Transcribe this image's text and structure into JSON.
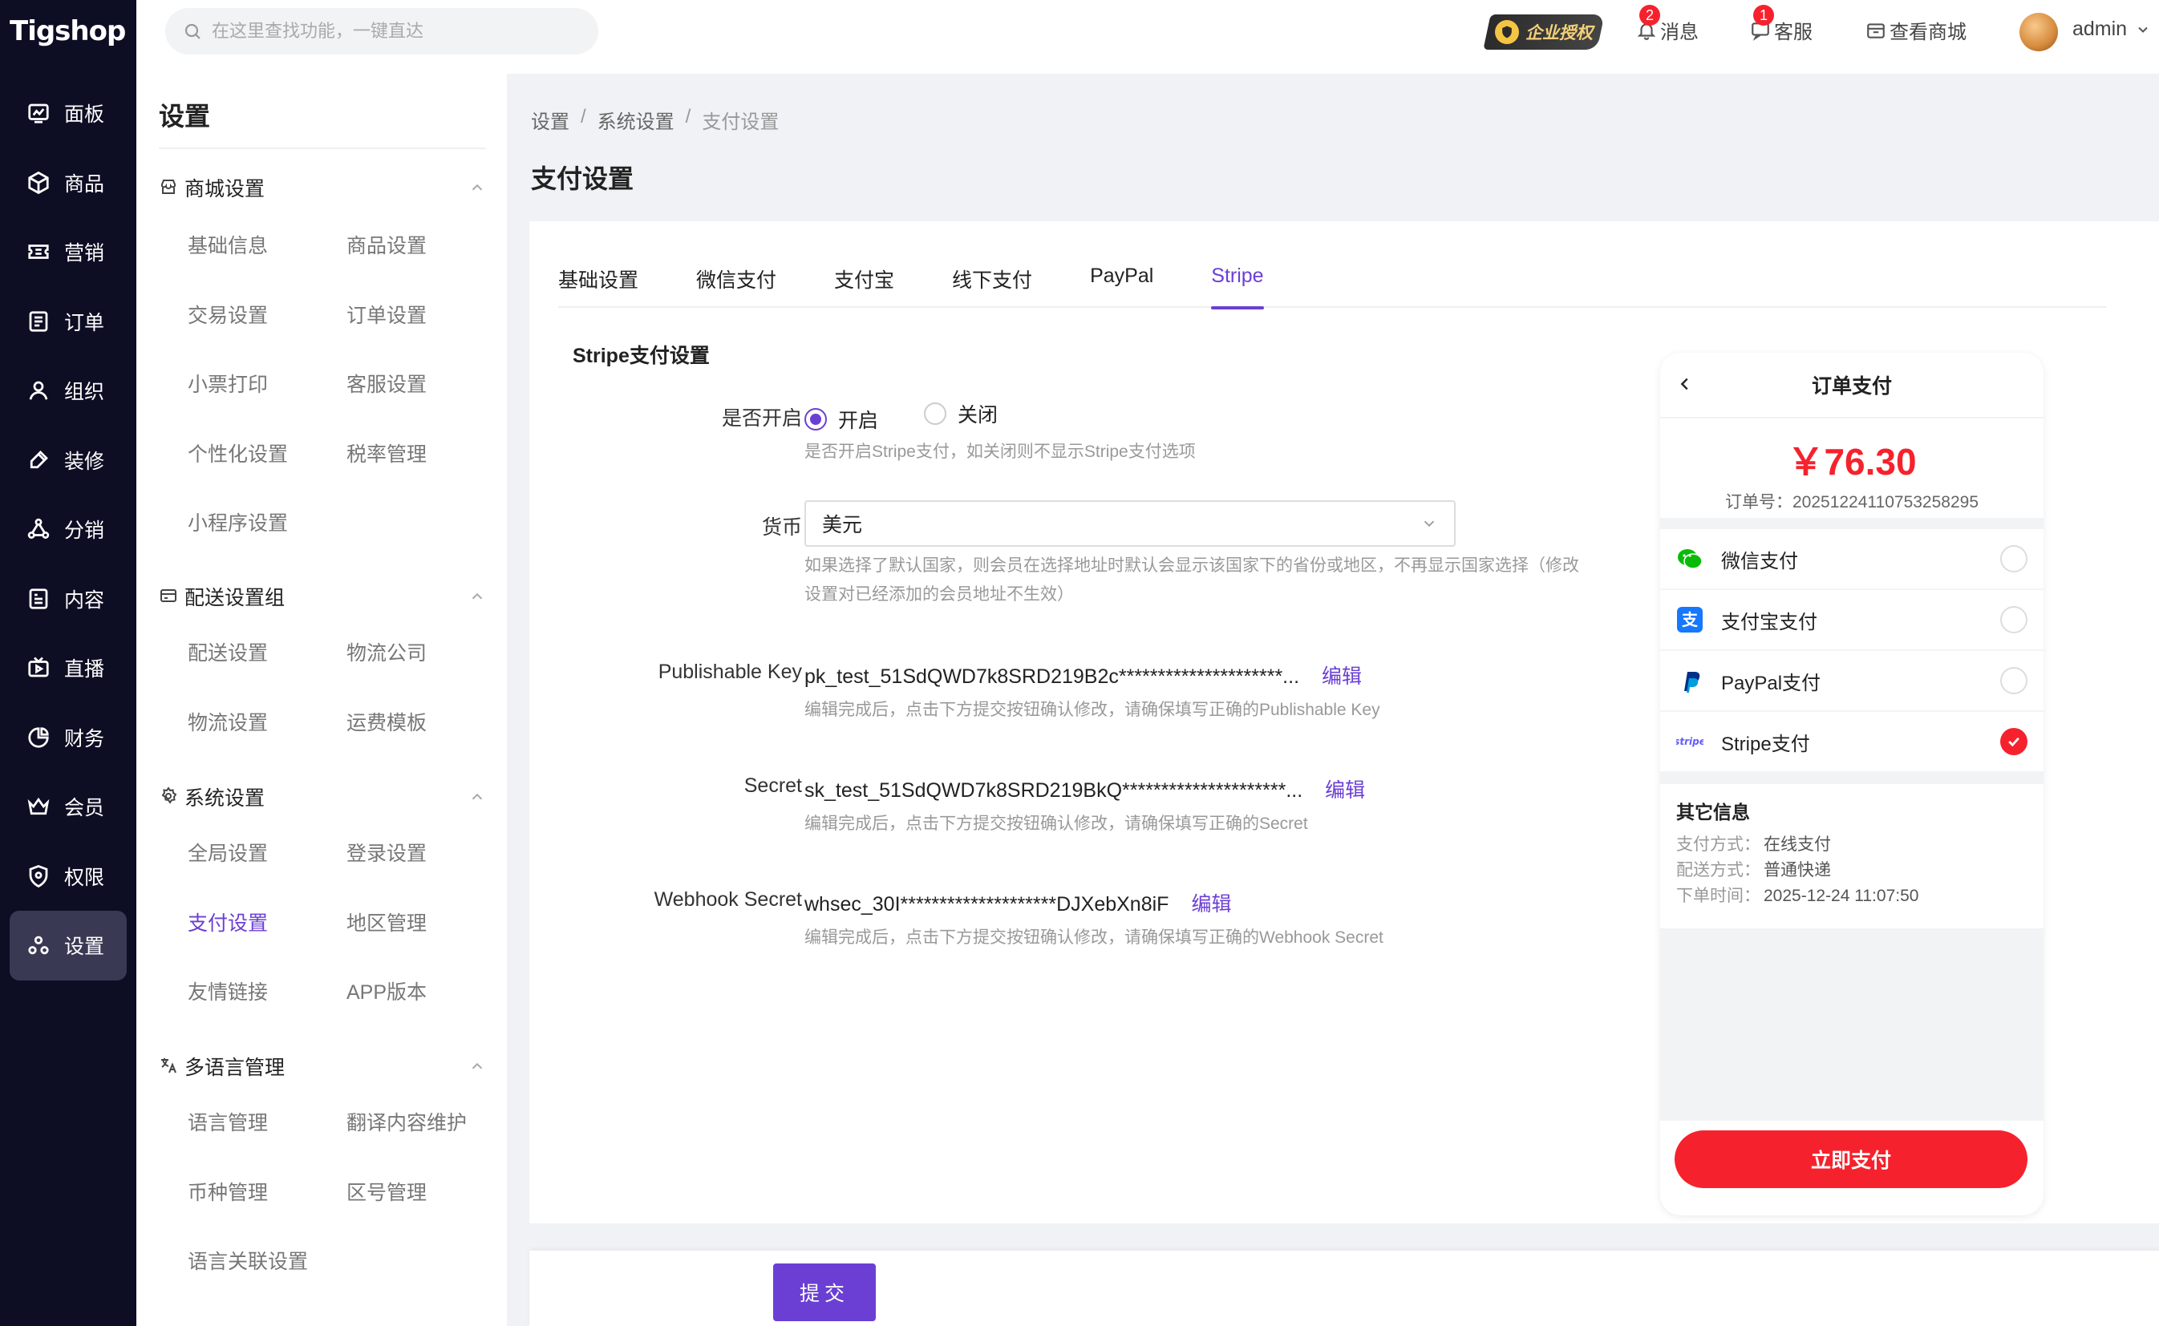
{
  "brand": {
    "logo_text": "Tigshop"
  },
  "search": {
    "placeholder": "在这里查找功能，一键直达"
  },
  "topbar": {
    "auth_label": "企业授权",
    "messages_label": "消息",
    "messages_count": "2",
    "service_label": "客服",
    "service_count": "1",
    "store_label": "查看商城",
    "user_name": "admin"
  },
  "rail": {
    "items": [
      {
        "label": "面板",
        "icon": "dashboard-icon"
      },
      {
        "label": "商品",
        "icon": "box-icon"
      },
      {
        "label": "营销",
        "icon": "coupon-icon"
      },
      {
        "label": "订单",
        "icon": "order-icon"
      },
      {
        "label": "组织",
        "icon": "user-icon"
      },
      {
        "label": "装修",
        "icon": "brush-icon"
      },
      {
        "label": "分销",
        "icon": "share-icon"
      },
      {
        "label": "内容",
        "icon": "content-icon"
      },
      {
        "label": "直播",
        "icon": "live-icon"
      },
      {
        "label": "财务",
        "icon": "pie-icon"
      },
      {
        "label": "会员",
        "icon": "crown-icon"
      },
      {
        "label": "权限",
        "icon": "shield-icon"
      },
      {
        "label": "设置",
        "icon": "settings-icon",
        "active": true
      }
    ]
  },
  "subside": {
    "title": "设置",
    "groups": [
      {
        "title": "商城设置",
        "items": [
          "基础信息",
          "商品设置",
          "交易设置",
          "订单设置",
          "小票打印",
          "客服设置",
          "个性化设置",
          "税率管理",
          "小程序设置"
        ]
      },
      {
        "title": "配送设置组",
        "items": [
          "配送设置",
          "物流公司",
          "物流设置",
          "运费模板"
        ]
      },
      {
        "title": "系统设置",
        "items": [
          "全局设置",
          "登录设置",
          "支付设置",
          "地区管理",
          "友情链接",
          "APP版本"
        ]
      },
      {
        "title": "多语言管理",
        "items": [
          "语言管理",
          "翻译内容维护",
          "币种管理",
          "区号管理",
          "语言关联设置"
        ]
      }
    ]
  },
  "breadcrumb": [
    "设置",
    "系统设置",
    "支付设置"
  ],
  "page_title": "支付设置",
  "tabs": [
    "基础设置",
    "微信支付",
    "支付宝",
    "线下支付",
    "PayPal",
    "Stripe"
  ],
  "form": {
    "section_title": "Stripe支付设置",
    "enable": {
      "label": "是否开启",
      "on": "开启",
      "off": "关闭",
      "help": "是否开启Stripe支付，如关闭则不显示Stripe支付选项"
    },
    "currency": {
      "label": "货币",
      "value": "美元",
      "help": "如果选择了默认国家，则会员在选择地址时默认会显示该国家下的省份或地区，不再显示国家选择（修改设置对已经添加的会员地址不生效）"
    },
    "publishable": {
      "label": "Publishable Key",
      "value": "pk_test_51SdQWD7k8SRD219B2c*********************...",
      "edit": "编辑",
      "help": "编辑完成后，点击下方提交按钮确认修改，请确保填写正确的Publishable Key"
    },
    "secret": {
      "label": "Secret",
      "value": "sk_test_51SdQWD7k8SRD219BkQ*********************...",
      "edit": "编辑",
      "help": "编辑完成后，点击下方提交按钮确认修改，请确保填写正确的Secret"
    },
    "webhook": {
      "label": "Webhook Secret",
      "value": "whsec_30I********************DJXebXn8iF",
      "edit": "编辑",
      "help": "编辑完成后，点击下方提交按钮确认修改，请确保填写正确的Webhook Secret"
    }
  },
  "preview": {
    "title": "订单支付",
    "price": "￥76.30",
    "order_no": "订单号：20251224110753258295",
    "methods": [
      {
        "label": "微信支付",
        "icon": "wechat-icon",
        "checked": false
      },
      {
        "label": "支付宝支付",
        "icon": "alipay-icon",
        "checked": false
      },
      {
        "label": "PayPal支付",
        "icon": "paypal-icon",
        "checked": false
      },
      {
        "label": "Stripe支付",
        "icon": "stripe-icon",
        "checked": true
      }
    ],
    "other_title": "其它信息",
    "pay_type_label": "支付方式：",
    "pay_type": "在线支付",
    "ship_label": "配送方式：",
    "ship": "普通快递",
    "time_label": "下单时间：",
    "time": "2025-12-24 11:07:50",
    "pay_button": "立即支付"
  },
  "submit_label": "提交",
  "colors": {
    "accent": "#6b3fd4",
    "rail_bg": "#0d0d24",
    "price_red": "#f5222d"
  }
}
